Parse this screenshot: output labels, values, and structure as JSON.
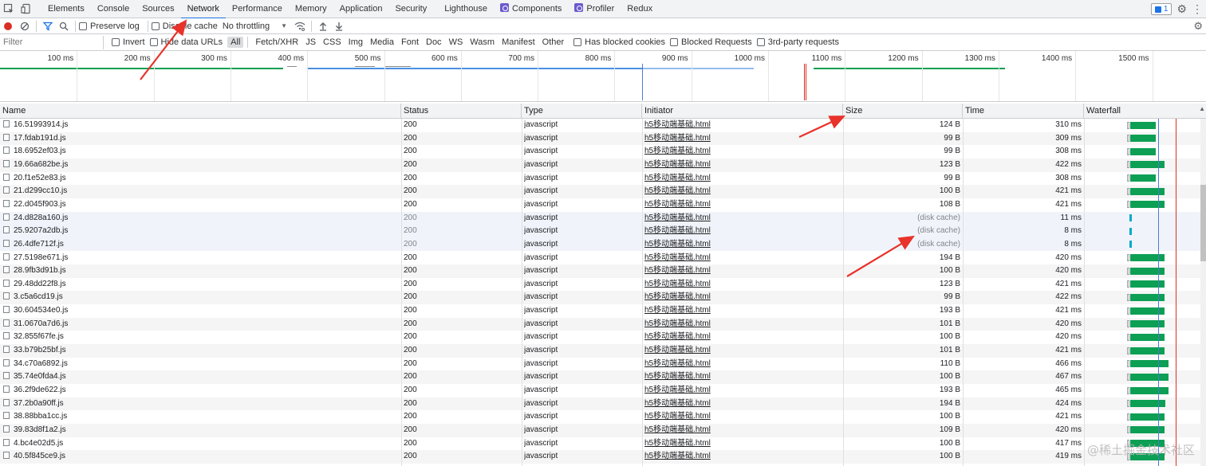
{
  "tabs": [
    {
      "label": "Elements",
      "name": "tab-elements"
    },
    {
      "label": "Console",
      "name": "tab-console"
    },
    {
      "label": "Sources",
      "name": "tab-sources"
    },
    {
      "label": "Network",
      "name": "tab-network",
      "active": true
    },
    {
      "label": "Performance",
      "name": "tab-performance"
    },
    {
      "label": "Memory",
      "name": "tab-memory"
    },
    {
      "label": "Application",
      "name": "tab-application"
    },
    {
      "label": "Security",
      "name": "tab-security"
    },
    {
      "label": "Lighthouse",
      "name": "tab-lighthouse"
    },
    {
      "label": "Components",
      "name": "tab-components",
      "icon": "react-icon"
    },
    {
      "label": "Profiler",
      "name": "tab-profiler",
      "icon": "react-icon"
    },
    {
      "label": "Redux",
      "name": "tab-redux"
    }
  ],
  "issues_count": "1",
  "toolbar": {
    "preserve_log": "Preserve log",
    "disable_cache": "Disable cache",
    "throttling": "No throttling"
  },
  "filter": {
    "placeholder": "Filter",
    "invert": "Invert",
    "hide_data_urls": "Hide data URLs",
    "types": [
      "All",
      "Fetch/XHR",
      "JS",
      "CSS",
      "Img",
      "Media",
      "Font",
      "Doc",
      "WS",
      "Wasm",
      "Manifest",
      "Other"
    ],
    "has_blocked_cookies": "Has blocked cookies",
    "blocked_requests": "Blocked Requests",
    "third_party": "3rd-party requests"
  },
  "overview_ticks": [
    "100 ms",
    "200 ms",
    "300 ms",
    "400 ms",
    "500 ms",
    "600 ms",
    "700 ms",
    "800 ms",
    "900 ms",
    "1000 ms",
    "1100 ms",
    "1200 ms",
    "1300 ms",
    "1400 ms",
    "1500 ms",
    "16"
  ],
  "columns": {
    "name": "Name",
    "status": "Status",
    "type": "Type",
    "initiator": "Initiator",
    "size": "Size",
    "time": "Time",
    "waterfall": "Waterfall"
  },
  "rows": [
    {
      "name": "16.51993914.js",
      "status": "200",
      "type": "javascript",
      "initiator": "h5移动端基础.html",
      "size": "124 B",
      "time": "310 ms",
      "ms": 310
    },
    {
      "name": "17.fdab191d.js",
      "status": "200",
      "type": "javascript",
      "initiator": "h5移动端基础.html",
      "size": "99 B",
      "time": "309 ms",
      "ms": 309
    },
    {
      "name": "18.6952ef03.js",
      "status": "200",
      "type": "javascript",
      "initiator": "h5移动端基础.html",
      "size": "99 B",
      "time": "308 ms",
      "ms": 308
    },
    {
      "name": "19.66a682be.js",
      "status": "200",
      "type": "javascript",
      "initiator": "h5移动端基础.html",
      "size": "123 B",
      "time": "422 ms",
      "ms": 422
    },
    {
      "name": "20.f1e52e83.js",
      "status": "200",
      "type": "javascript",
      "initiator": "h5移动端基础.html",
      "size": "99 B",
      "time": "308 ms",
      "ms": 308
    },
    {
      "name": "21.d299cc10.js",
      "status": "200",
      "type": "javascript",
      "initiator": "h5移动端基础.html",
      "size": "100 B",
      "time": "421 ms",
      "ms": 421
    },
    {
      "name": "22.d045f903.js",
      "status": "200",
      "type": "javascript",
      "initiator": "h5移动端基础.html",
      "size": "108 B",
      "time": "421 ms",
      "ms": 421
    },
    {
      "name": "24.d828a160.js",
      "status": "200",
      "type": "javascript",
      "initiator": "h5移动端基础.html",
      "size": "(disk cache)",
      "time": "11 ms",
      "ms": 11,
      "cached": true
    },
    {
      "name": "25.9207a2db.js",
      "status": "200",
      "type": "javascript",
      "initiator": "h5移动端基础.html",
      "size": "(disk cache)",
      "time": "8 ms",
      "ms": 8,
      "cached": true
    },
    {
      "name": "26.4dfe712f.js",
      "status": "200",
      "type": "javascript",
      "initiator": "h5移动端基础.html",
      "size": "(disk cache)",
      "time": "8 ms",
      "ms": 8,
      "cached": true
    },
    {
      "name": "27.5198e671.js",
      "status": "200",
      "type": "javascript",
      "initiator": "h5移动端基础.html",
      "size": "194 B",
      "time": "420 ms",
      "ms": 420
    },
    {
      "name": "28.9fb3d91b.js",
      "status": "200",
      "type": "javascript",
      "initiator": "h5移动端基础.html",
      "size": "100 B",
      "time": "420 ms",
      "ms": 420
    },
    {
      "name": "29.48dd22f8.js",
      "status": "200",
      "type": "javascript",
      "initiator": "h5移动端基础.html",
      "size": "123 B",
      "time": "421 ms",
      "ms": 421
    },
    {
      "name": "3.c5a6cd19.js",
      "status": "200",
      "type": "javascript",
      "initiator": "h5移动端基础.html",
      "size": "99 B",
      "time": "422 ms",
      "ms": 422
    },
    {
      "name": "30.604534e0.js",
      "status": "200",
      "type": "javascript",
      "initiator": "h5移动端基础.html",
      "size": "193 B",
      "time": "421 ms",
      "ms": 421
    },
    {
      "name": "31.0670a7d6.js",
      "status": "200",
      "type": "javascript",
      "initiator": "h5移动端基础.html",
      "size": "101 B",
      "time": "420 ms",
      "ms": 420
    },
    {
      "name": "32.855f67fe.js",
      "status": "200",
      "type": "javascript",
      "initiator": "h5移动端基础.html",
      "size": "100 B",
      "time": "420 ms",
      "ms": 420
    },
    {
      "name": "33.b79b25bf.js",
      "status": "200",
      "type": "javascript",
      "initiator": "h5移动端基础.html",
      "size": "101 B",
      "time": "421 ms",
      "ms": 421
    },
    {
      "name": "34.c70a6892.js",
      "status": "200",
      "type": "javascript",
      "initiator": "h5移动端基础.html",
      "size": "110 B",
      "time": "466 ms",
      "ms": 466
    },
    {
      "name": "35.74e0fda4.js",
      "status": "200",
      "type": "javascript",
      "initiator": "h5移动端基础.html",
      "size": "100 B",
      "time": "467 ms",
      "ms": 467
    },
    {
      "name": "36.2f9de622.js",
      "status": "200",
      "type": "javascript",
      "initiator": "h5移动端基础.html",
      "size": "193 B",
      "time": "465 ms",
      "ms": 465
    },
    {
      "name": "37.2b0a90ff.js",
      "status": "200",
      "type": "javascript",
      "initiator": "h5移动端基础.html",
      "size": "194 B",
      "time": "424 ms",
      "ms": 424
    },
    {
      "name": "38.88bba1cc.js",
      "status": "200",
      "type": "javascript",
      "initiator": "h5移动端基础.html",
      "size": "100 B",
      "time": "421 ms",
      "ms": 421
    },
    {
      "name": "39.83d8f1a2.js",
      "status": "200",
      "type": "javascript",
      "initiator": "h5移动端基础.html",
      "size": "109 B",
      "time": "420 ms",
      "ms": 420
    },
    {
      "name": "4.bc4e02d5.js",
      "status": "200",
      "type": "javascript",
      "initiator": "h5移动端基础.html",
      "size": "100 B",
      "time": "417 ms",
      "ms": 417
    },
    {
      "name": "40.5f845ce9.js",
      "status": "200",
      "type": "javascript",
      "initiator": "h5移动端基础.html",
      "size": "100 B",
      "time": "419 ms",
      "ms": 419
    }
  ],
  "watermark": "@稀土掘金技术社区",
  "colors": {
    "accent": "#1a73e8",
    "record": "#d93025",
    "waterfall_bar": "#0d9f54",
    "cache_bar": "#00a9c9",
    "annotation_arrow": "#e8322a"
  }
}
